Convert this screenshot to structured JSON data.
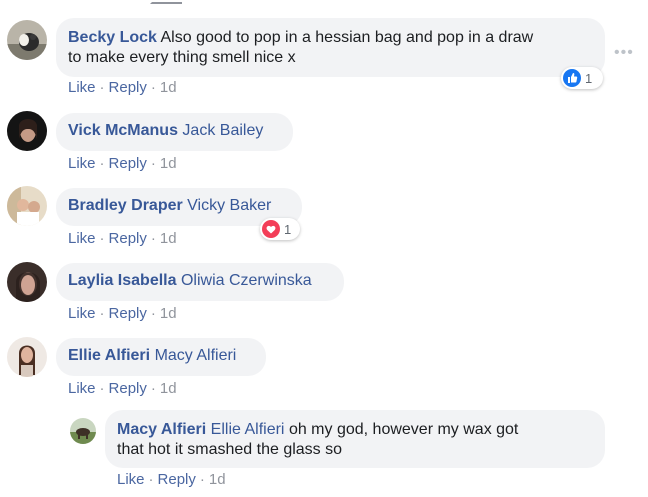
{
  "comments": [
    {
      "author": "Becky Lock",
      "text_line1": "Also good to pop in a hessian bag and pop in a draw",
      "text_line2": "to make every thing smell nice x",
      "like": "Like",
      "reply": "Reply",
      "time": "1d",
      "reaction_count": "1",
      "reaction_icon": "like-icon"
    },
    {
      "author": "Vick McManus",
      "tag": "Jack Bailey",
      "like": "Like",
      "reply": "Reply",
      "time": "1d"
    },
    {
      "author": "Bradley Draper",
      "tag": "Vicky Baker",
      "like": "Like",
      "reply": "Reply",
      "time": "1d",
      "reaction_count": "1",
      "reaction_icon": "love-icon"
    },
    {
      "author": "Laylia Isabella",
      "tag": "Oliwia Czerwinska",
      "like": "Like",
      "reply": "Reply",
      "time": "1d"
    },
    {
      "author": "Ellie Alfieri",
      "tag": "Macy Alfieri",
      "like": "Like",
      "reply": "Reply",
      "time": "1d"
    }
  ],
  "reply": {
    "author": "Macy Alfieri",
    "tag": "Ellie Alfieri",
    "text_line1": "oh my god, however my wax got",
    "text_line2": "that hot it smashed the glass so",
    "like": "Like",
    "reply": "Reply",
    "time": "1d"
  },
  "separator": "·",
  "more_icon": "more-options-icon",
  "colors": {
    "bubble": "#f2f3f5",
    "author": "#385898",
    "action_link": "#4b67a1",
    "meta": "#90949c",
    "like_blue": "#1877f2",
    "love_red": "#f33e58"
  }
}
